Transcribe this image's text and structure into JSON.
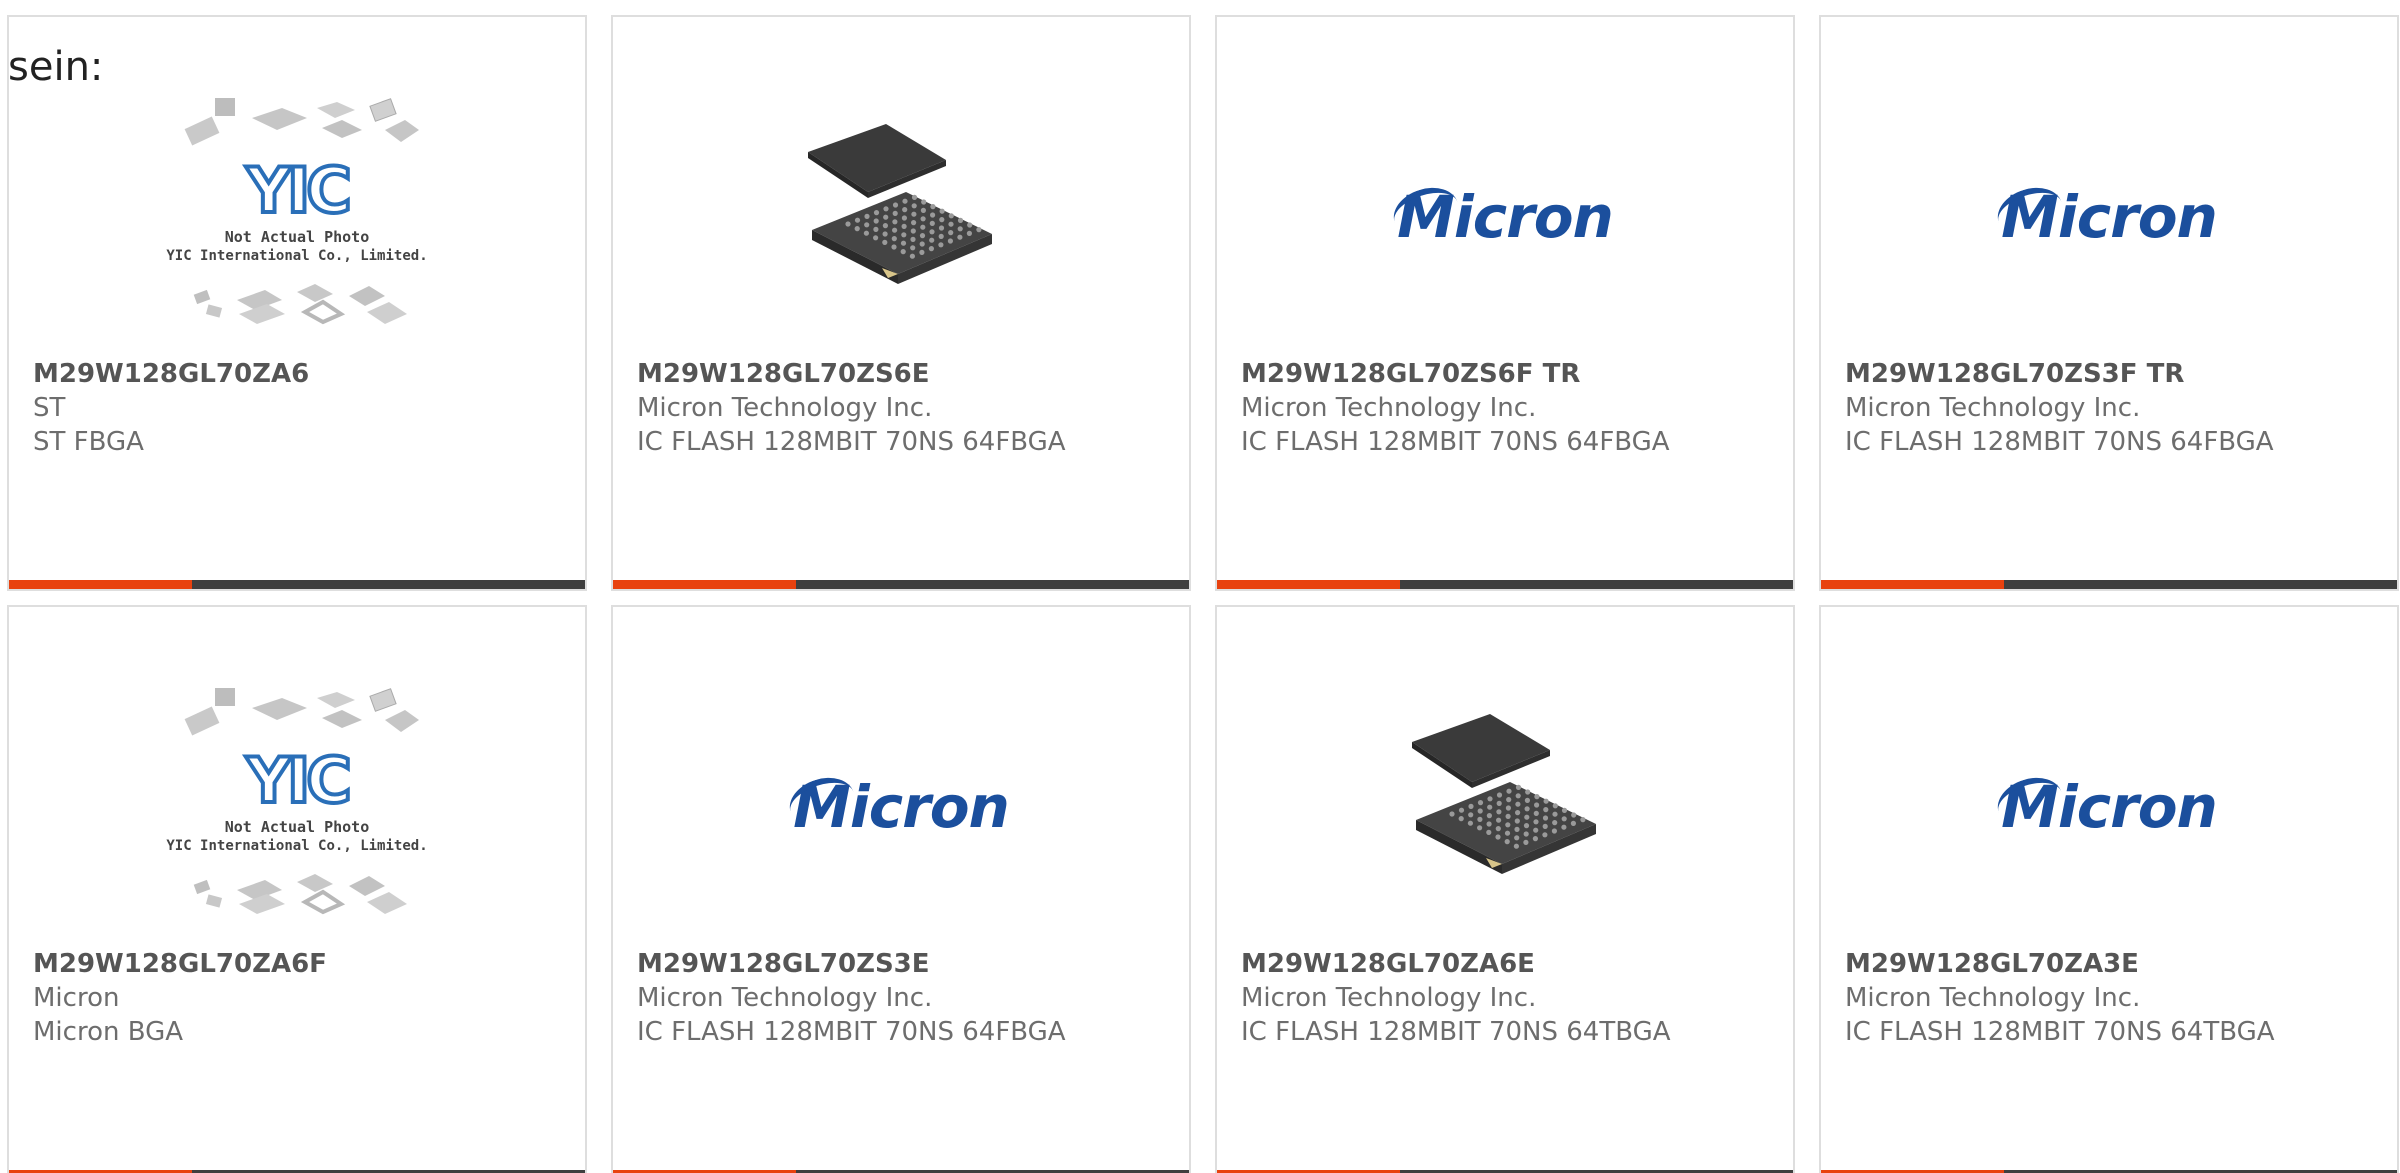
{
  "lead_text": "sein:",
  "watermark": {
    "line1": "Not Actual Photo",
    "line2": "YIC International Co., Limited.",
    "logo": "YIC"
  },
  "micron_logo_text": "Micron",
  "colors": {
    "accent": "#e8420f",
    "bar": "#3f3f3f",
    "micron_blue": "#1b4f9d",
    "yic_blue": "#2a6fb8"
  },
  "products": [
    {
      "part": "M29W128GL70ZA6",
      "maker": "ST",
      "desc": "ST FBGA",
      "image": "yic-placeholder"
    },
    {
      "part": "M29W128GL70ZS6E",
      "maker": "Micron Technology Inc.",
      "desc": "IC FLASH 128MBIT 70NS 64FBGA",
      "image": "bga-chip"
    },
    {
      "part": "M29W128GL70ZS6F TR",
      "maker": "Micron Technology Inc.",
      "desc": "IC FLASH 128MBIT 70NS 64FBGA",
      "image": "micron-logo"
    },
    {
      "part": "M29W128GL70ZS3F TR",
      "maker": "Micron Technology Inc.",
      "desc": "IC FLASH 128MBIT 70NS 64FBGA",
      "image": "micron-logo"
    },
    {
      "part": "M29W128GL70ZA6F",
      "maker": "Micron",
      "desc": "Micron BGA",
      "image": "yic-placeholder"
    },
    {
      "part": "M29W128GL70ZS3E",
      "maker": "Micron Technology Inc.",
      "desc": "IC FLASH 128MBIT 70NS 64FBGA",
      "image": "micron-logo"
    },
    {
      "part": "M29W128GL70ZA6E",
      "maker": "Micron Technology Inc.",
      "desc": "IC FLASH 128MBIT 70NS 64TBGA",
      "image": "bga-chip"
    },
    {
      "part": "M29W128GL70ZA3E",
      "maker": "Micron Technology Inc.",
      "desc": "IC FLASH 128MBIT 70NS 64TBGA",
      "image": "micron-logo"
    }
  ]
}
